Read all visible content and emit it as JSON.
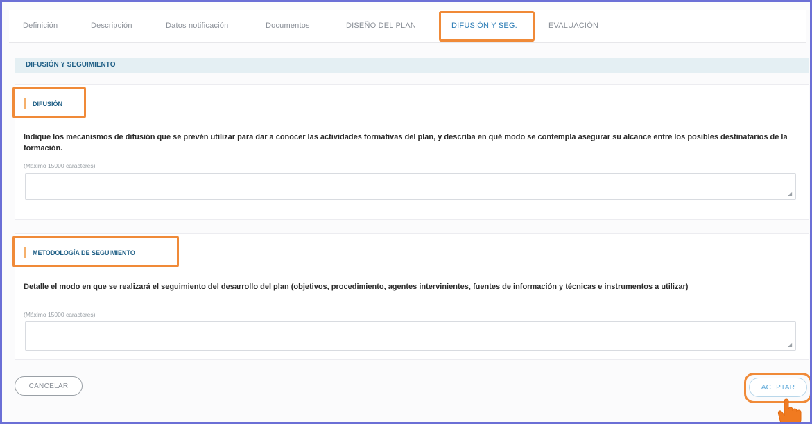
{
  "tabs": [
    {
      "label": "Definición"
    },
    {
      "label": "Descripción"
    },
    {
      "label": "Datos notificación"
    },
    {
      "label": "Documentos"
    },
    {
      "label": "DISEÑO DEL PLAN"
    },
    {
      "label": "DIFUSIÓN Y SEG."
    },
    {
      "label": "EVALUACIÓN"
    }
  ],
  "active_tab": "DIFUSIÓN Y SEG.",
  "section": {
    "title": "DIFUSIÓN Y SEGUIMIENTO"
  },
  "difusion": {
    "title": "DIFUSIÓN",
    "question": "Indique los mecanismos de difusión que se prevén utilizar para dar a conocer las actividades formativas del plan, y describa en qué modo se contempla asegurar su alcance entre los posibles destinatarios de la formación.",
    "hint": "(Máximo 15000 caracteres)",
    "value": ""
  },
  "metodologia": {
    "title": "METODOLOGÍA DE SEGUIMIENTO",
    "question": "Detalle el modo en que se realizará el seguimiento del desarrollo del plan (objetivos, procedimiento, agentes intervinientes, fuentes de información y técnicas e instrumentos a utilizar)",
    "hint": "(Máximo 15000 caracteres)",
    "value": ""
  },
  "buttons": {
    "cancel": "CANCELAR",
    "accept": "ACEPTAR"
  },
  "colors": {
    "highlight": "#f08a38",
    "accent": "#1f5f86",
    "frame": "#6b6fd6",
    "strip": "#e4eff3"
  }
}
